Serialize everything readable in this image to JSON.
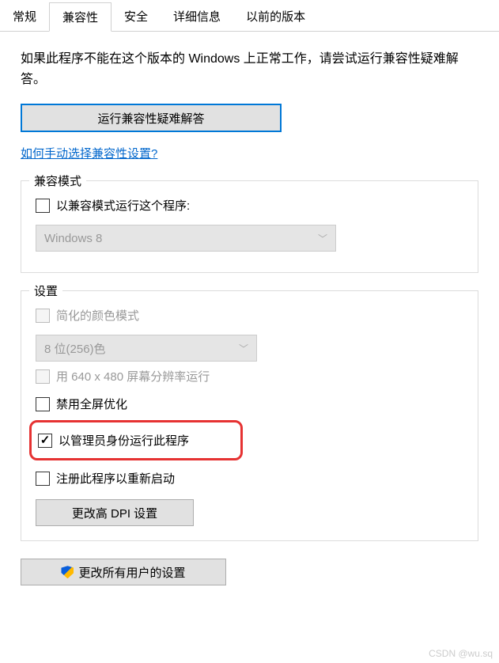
{
  "tabs": {
    "general": "常规",
    "compatibility": "兼容性",
    "security": "安全",
    "details": "详细信息",
    "previous": "以前的版本"
  },
  "intro": "如果此程序不能在这个版本的 Windows 上正常工作，请尝试运行兼容性疑难解答。",
  "troubleshoot_button": "运行兼容性疑难解答",
  "manual_link": "如何手动选择兼容性设置?",
  "compat_mode": {
    "title": "兼容模式",
    "checkbox_label": "以兼容模式运行这个程序:",
    "dropdown_value": "Windows 8"
  },
  "settings": {
    "title": "设置",
    "reduced_color_label": "简化的颜色模式",
    "color_dropdown_value": "8 位(256)色",
    "run_640_label": "用 640 x 480 屏幕分辨率运行",
    "disable_fullscreen_label": "禁用全屏优化",
    "run_admin_label": "以管理员身份运行此程序",
    "register_restart_label": "注册此程序以重新启动",
    "dpi_button": "更改高 DPI 设置"
  },
  "all_users_button": "更改所有用户的设置",
  "watermark": "CSDN @wu.sq"
}
